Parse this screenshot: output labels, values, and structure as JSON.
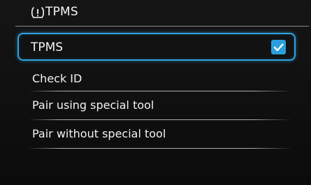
{
  "header": {
    "title": "TPMS",
    "icon": "tpms-warning-icon"
  },
  "menu": {
    "selected_item": {
      "label": "TPMS",
      "checked": true
    },
    "items": [
      {
        "label": "Check ID"
      },
      {
        "label": "Pair using special tool"
      },
      {
        "label": "Pair without special tool"
      }
    ]
  },
  "colors": {
    "accent": "#2ea3df",
    "background": "#121212",
    "text": "#f2f2f2"
  }
}
